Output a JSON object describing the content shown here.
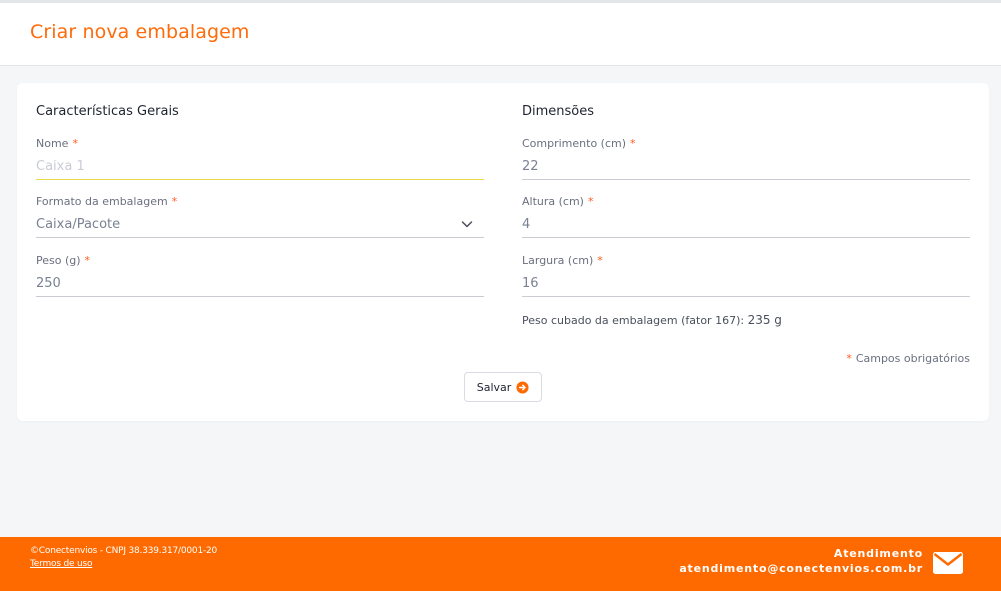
{
  "header": {
    "title": "Criar nova embalagem"
  },
  "general": {
    "title": "Características Gerais",
    "name": {
      "label": "Nome",
      "placeholder": "Caixa 1"
    },
    "format": {
      "label": "Formato da embalagem",
      "value": "Caixa/Pacote"
    },
    "weight": {
      "label": "Peso (g)",
      "value": "250"
    }
  },
  "dimensions": {
    "title": "Dimensões",
    "length": {
      "label": "Comprimento (cm)",
      "value": "22"
    },
    "height": {
      "label": "Altura (cm)",
      "value": "4"
    },
    "width": {
      "label": "Largura (cm)",
      "value": "16"
    },
    "cubed_label": "Peso cubado da embalagem (fator 167):",
    "cubed_value": "235 g"
  },
  "required_marker": "*",
  "required_note": "Campos obrigatórios",
  "actions": {
    "save_label": "Salvar"
  },
  "footer": {
    "copyright": "©Conectenvios - CNPJ 38.339.317/0001-20",
    "terms": "Termos de uso",
    "contact_title": "Atendimento",
    "contact_email": "atendimento@conectenvios.com.br"
  },
  "icons": {
    "format_toggle": "chevron-down-icon",
    "save": "arrow-right-circle-icon",
    "contact": "mail-icon"
  },
  "colors": {
    "accent": "#ff6a00",
    "required": "#ff5a1f",
    "focus_line": "#e8d94a"
  }
}
